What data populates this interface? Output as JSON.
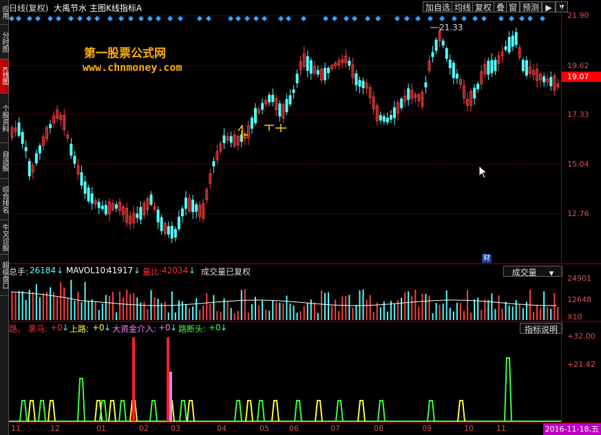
{
  "sidebar": {
    "tabs": [
      {
        "label": "应用",
        "active": false
      },
      {
        "label": "分时图",
        "active": false
      },
      {
        "label": "K线图",
        "active": true
      },
      {
        "label": "个股资料",
        "active": false
      },
      {
        "label": "自选股",
        "active": false
      },
      {
        "label": "综合排名",
        "active": false
      },
      {
        "label": "牛叉诊股",
        "active": false
      },
      {
        "label": "超级盘口",
        "active": false
      }
    ]
  },
  "topbar": {
    "period": "日线(复权)",
    "stock_name": "大禹节水",
    "main_chart": "主图K线指标A",
    "buttons": [
      "加自选",
      "均线",
      "复权",
      "叠",
      "窗",
      "预测"
    ]
  },
  "watermark": {
    "line1": "第一股票公式网",
    "line2": "www.chnmoney.com"
  },
  "price_axis": {
    "labels": [
      "21.90",
      "19.62",
      "17.33",
      "15.04",
      "12.76"
    ],
    "current": "19.07"
  },
  "price_chart": {
    "max_label": "21.33",
    "marker_cai": "财"
  },
  "volume_panel": {
    "items": [
      {
        "label": "总手: ",
        "value": "26184",
        "arrow": "↓"
      },
      {
        "label": "MAVOL10: ",
        "value": "41917",
        "arrow": "↓"
      },
      {
        "label": "量比: ",
        "value": "42034",
        "arrow": "↓"
      }
    ],
    "note": "成交量已复权",
    "selector": "成交量",
    "axis": [
      "24901",
      "12648"
    ],
    "unit": "X10"
  },
  "indicator_panel": {
    "prefix": "路。",
    "items": [
      {
        "label": "黑马: ",
        "value": "+0",
        "arrow": "↓",
        "color": "#ff3030"
      },
      {
        "label": "上路: ",
        "value": "+0",
        "arrow": "↓",
        "color": "#ffff40"
      },
      {
        "label": "大资金介入: ",
        "value": "+0",
        "arrow": "↓",
        "color": "#ff80ff"
      },
      {
        "label": "路断头: ",
        "value": "+0",
        "arrow": "↓",
        "color": "#40ff40"
      }
    ],
    "help_button": "指标说明",
    "axis": [
      "+32.00",
      "+21.42"
    ]
  },
  "x_axis": {
    "labels": [
      "11",
      "12",
      "01",
      "02",
      "03",
      "04",
      "05",
      "06",
      "07",
      "08",
      "09",
      "10",
      "11"
    ],
    "current_date": "2016-11-18,五"
  },
  "colors": {
    "up": "#ff4040",
    "down": "#54ffff",
    "accent": "#ff0000",
    "diamond": "#3aa0ff"
  }
}
